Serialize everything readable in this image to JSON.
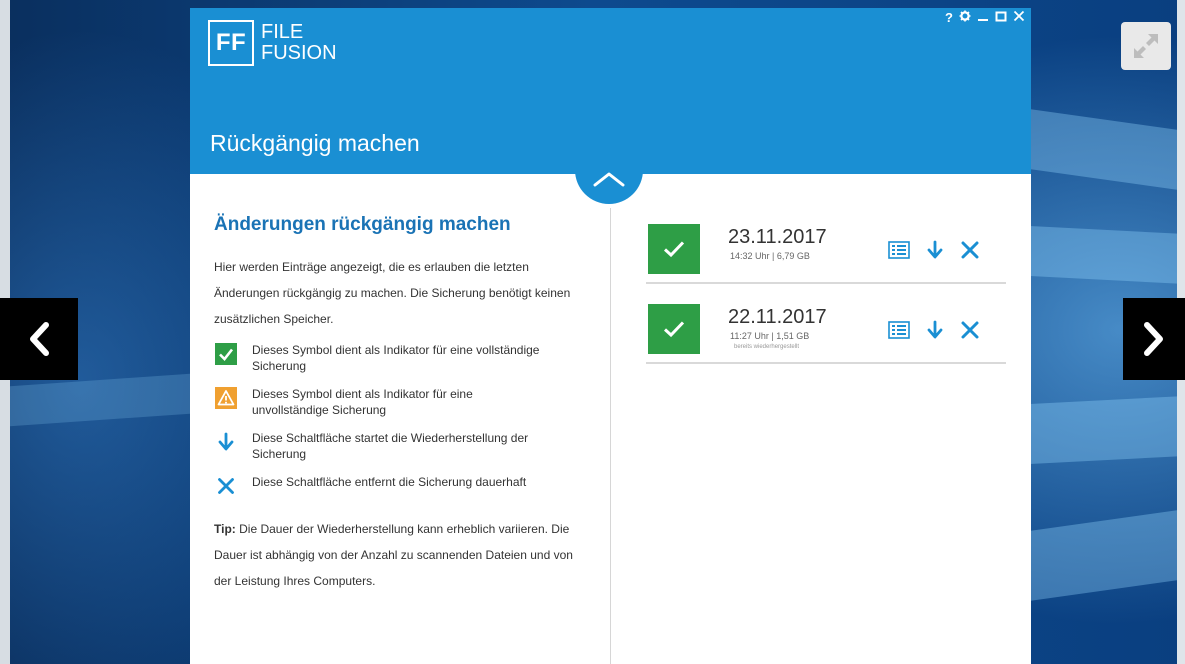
{
  "window": {
    "controls": [
      "?",
      "gear",
      "minimize",
      "maximize",
      "close"
    ]
  },
  "logo": {
    "mark": "FF",
    "line1": "FILE",
    "line2": "FUSION"
  },
  "header": {
    "title": "Rückgängig machen"
  },
  "left": {
    "heading": "Änderungen rückgängig machen",
    "intro": "Hier werden Einträge angezeigt, die es erlauben die letzten Änderungen rückgängig zu machen. Die Sicherung benötigt keinen zusätzlichen Speicher.",
    "legend": [
      {
        "icon": "check-icon",
        "text": "Dieses Symbol dient als Indikator für eine vollständige Sicherung"
      },
      {
        "icon": "warning-icon",
        "text": "Dieses Symbol dient als Indikator für eine unvollständige Sicherung"
      },
      {
        "icon": "arrow-down-icon",
        "text": "Diese Schaltfläche startet die Wiederherstellung der Sicherung"
      },
      {
        "icon": "close-icon",
        "text": "Diese Schaltfläche entfernt die Sicherung dauerhaft"
      }
    ],
    "tip_label": "Tip:",
    "tip_text": "Die Dauer der Wiederherstellung kann erheblich variieren. Die Dauer ist abhängig von der Anzahl zu scannenden Dateien und von der Leistung Ihres Computers."
  },
  "entries": [
    {
      "date": "23.11.2017",
      "meta": "14:32 Uhr  |  6,79 GB",
      "note": ""
    },
    {
      "date": "22.11.2017",
      "meta": "11:27 Uhr  |  1,51 GB",
      "note": "bereits wiederhergestellt"
    }
  ],
  "colors": {
    "accent": "#1a8fd3",
    "success": "#2e9e46",
    "warning": "#f0a030",
    "heading": "#1a73b5"
  }
}
